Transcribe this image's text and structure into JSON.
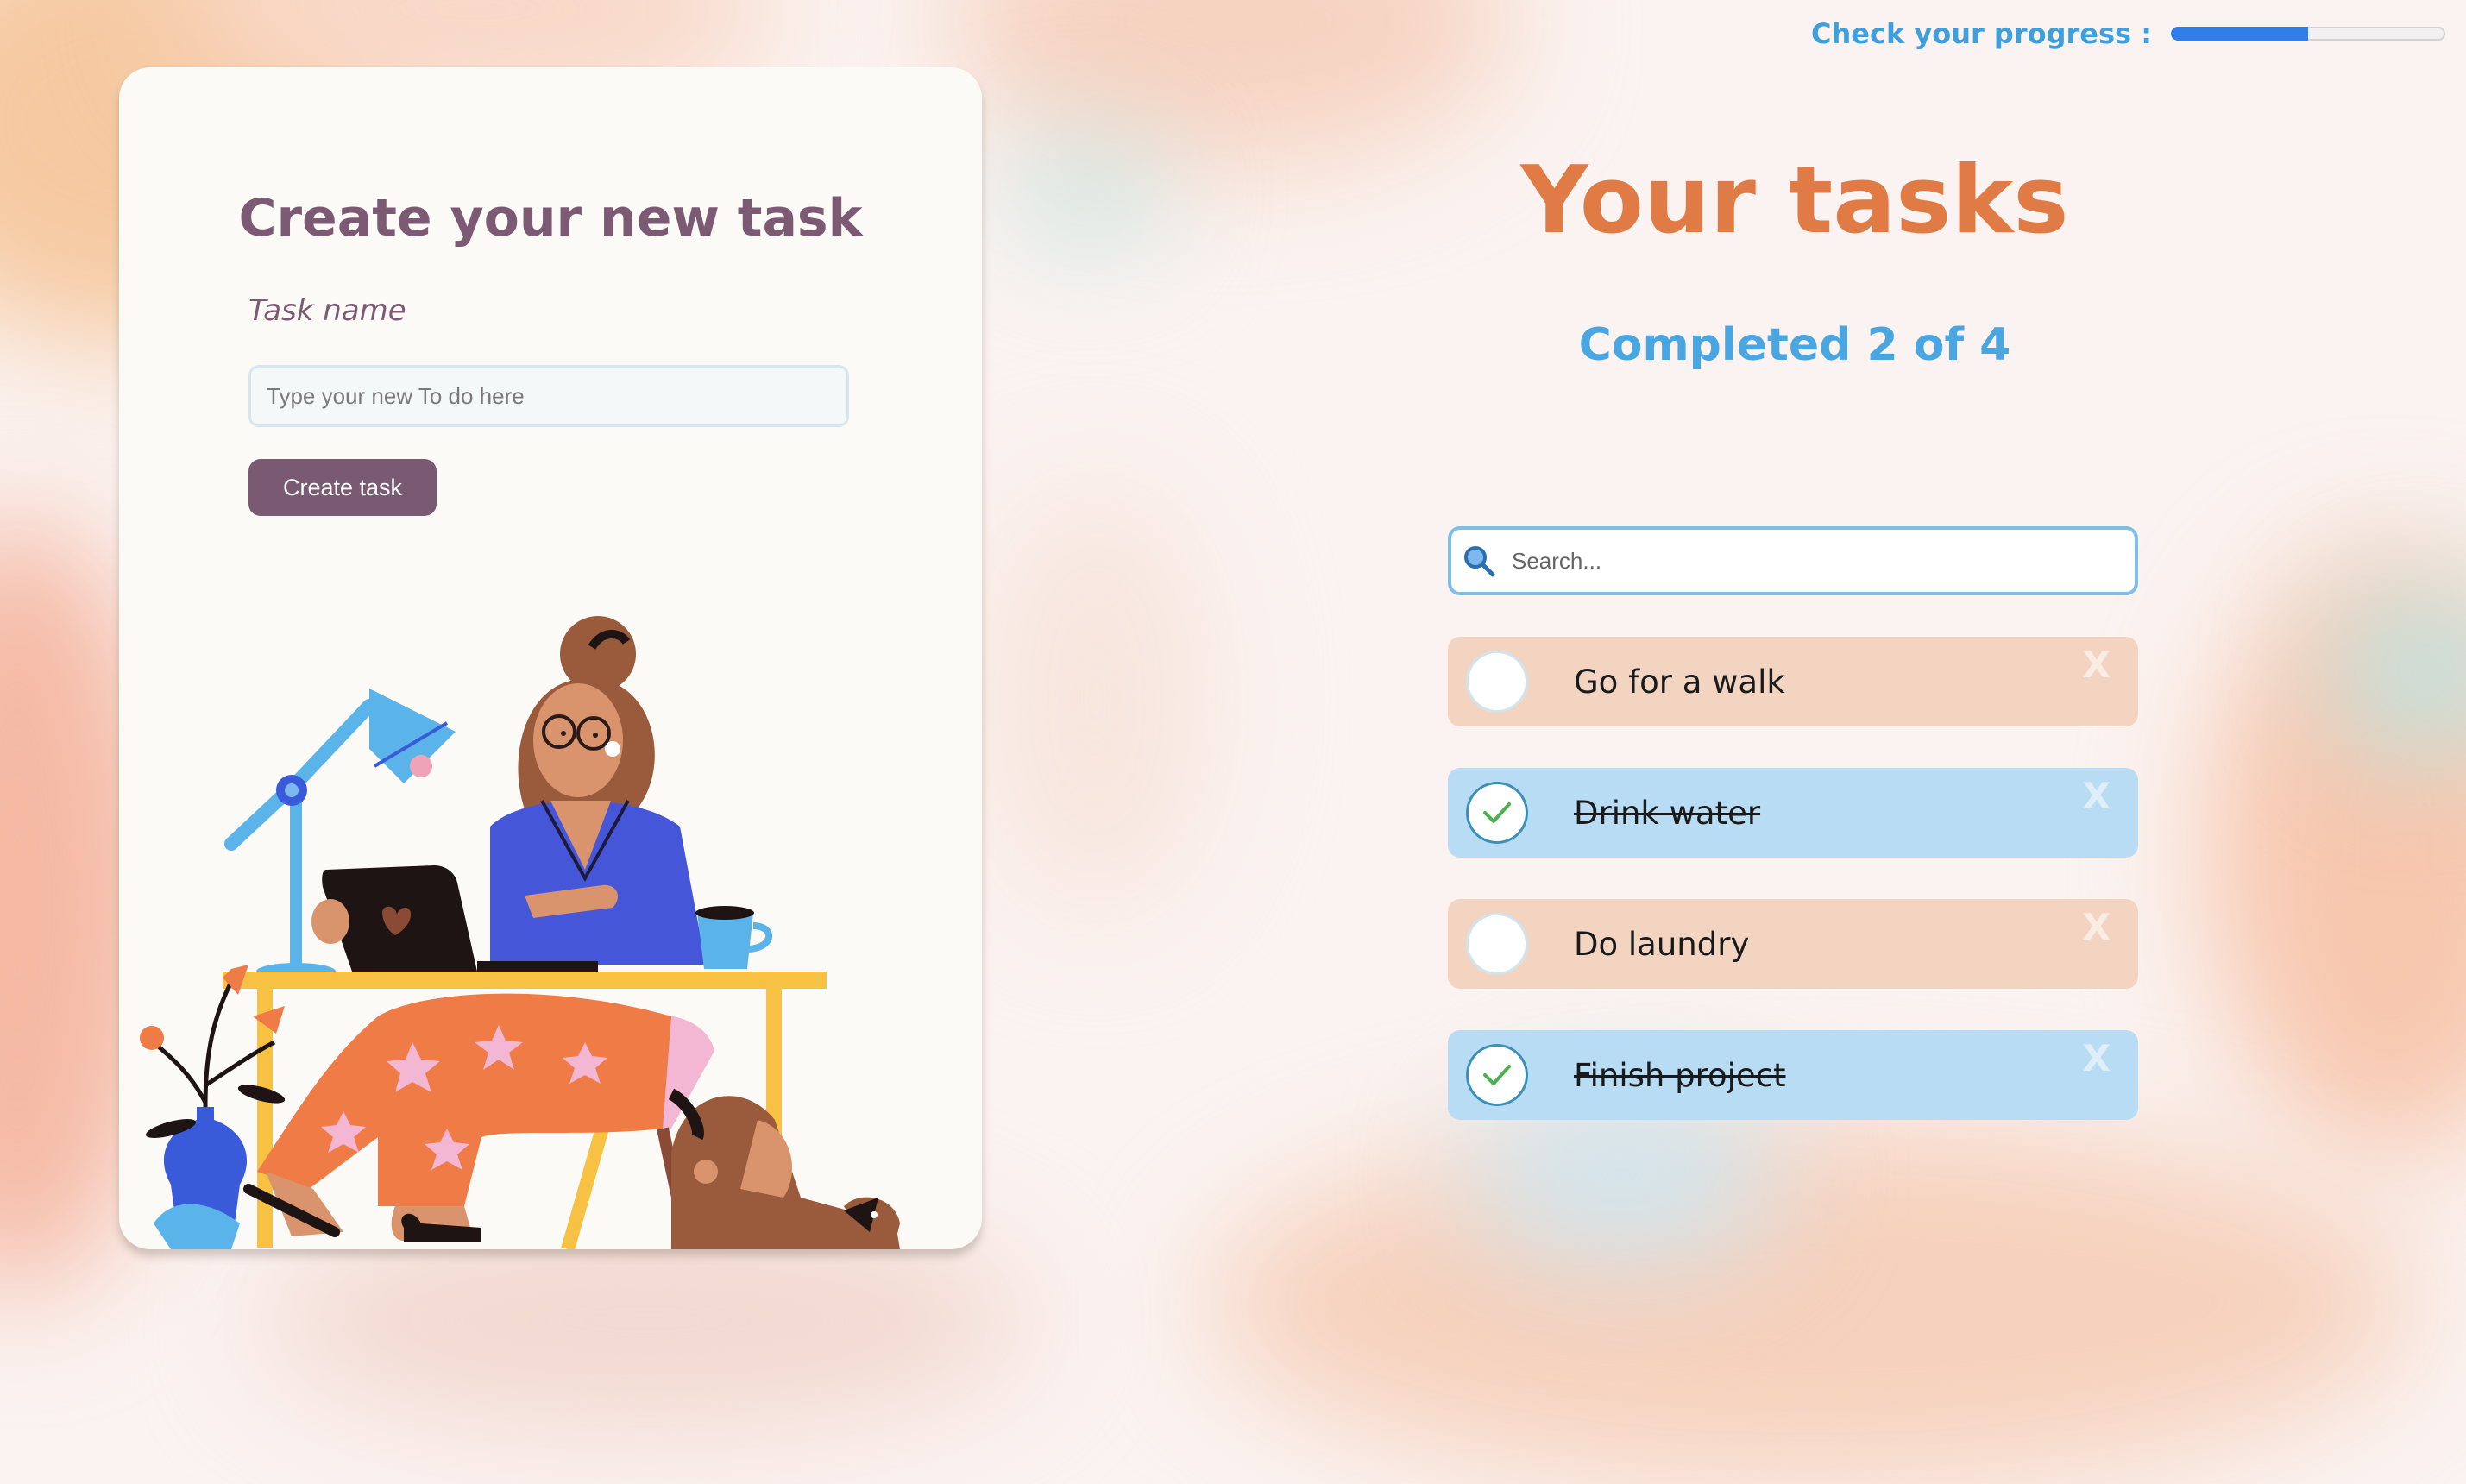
{
  "progress": {
    "label": "Check your progress :",
    "fraction": 0.5
  },
  "create": {
    "title": "Create your new task",
    "label": "Task name",
    "placeholder": "Type your new To do here",
    "button": "Create task"
  },
  "tasks_panel": {
    "title": "Your tasks",
    "completed_text": "Completed 2 of 4",
    "search_placeholder": "Search..."
  },
  "tasks": [
    {
      "name": "Go for a walk",
      "done": false,
      "delete": "X"
    },
    {
      "name": "Drink water",
      "done": true,
      "delete": "X"
    },
    {
      "name": "Do laundry",
      "done": false,
      "delete": "X"
    },
    {
      "name": "Finish project",
      "done": true,
      "delete": "X"
    }
  ],
  "colors": {
    "accent_orange": "#e07b45",
    "accent_blue": "#4aa6e0",
    "button_purple": "#7a5a72",
    "task_pending": "#f3d4c1",
    "task_done": "#b7dcf3"
  }
}
